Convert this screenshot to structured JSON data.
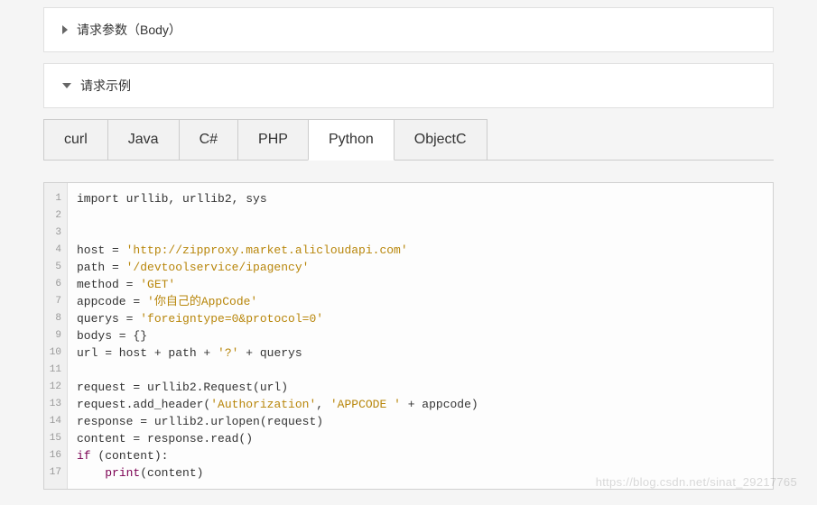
{
  "panels": {
    "body_params": "请求参数（Body）",
    "example": "请求示例"
  },
  "tabs": [
    "curl",
    "Java",
    "C#",
    "PHP",
    "Python",
    "ObjectC"
  ],
  "active_tab": "Python",
  "line_numbers": [
    "1",
    "2",
    "3",
    "4",
    "5",
    "6",
    "7",
    "8",
    "9",
    "10",
    "11",
    "12",
    "13",
    "14",
    "15",
    "16",
    "17"
  ],
  "code": {
    "l1_import": "import urllib, urllib2, sys",
    "l4_host_a": "host = ",
    "l4_host_b": "'http://zipproxy.market.alicloudapi.com'",
    "l5_path_a": "path = ",
    "l5_path_b": "'/devtoolservice/ipagency'",
    "l6_method_a": "method = ",
    "l6_method_b": "'GET'",
    "l7_appcode_a": "appcode = ",
    "l7_appcode_b": "'你自己的AppCode'",
    "l8_querys_a": "querys = ",
    "l8_querys_b": "'foreigntype=0&protocol=0'",
    "l9_bodys": "bodys = {}",
    "l10_url_a": "url = host + path + ",
    "l10_url_b": "'?'",
    "l10_url_c": " + querys",
    "l12_req": "request = urllib2.Request(url)",
    "l13_a": "request.add_header(",
    "l13_b": "'Authorization'",
    "l13_c": ", ",
    "l13_d": "'APPCODE '",
    "l13_e": " + appcode)",
    "l14_resp": "response = urllib2.urlopen(request)",
    "l15_content": "content = response.read()",
    "l16_if_kw": "if",
    "l16_if_rest": " (content):",
    "l17_indent": "    ",
    "l17_print": "print",
    "l17_args": "(content)"
  },
  "watermark": "https://blog.csdn.net/sinat_29217765"
}
